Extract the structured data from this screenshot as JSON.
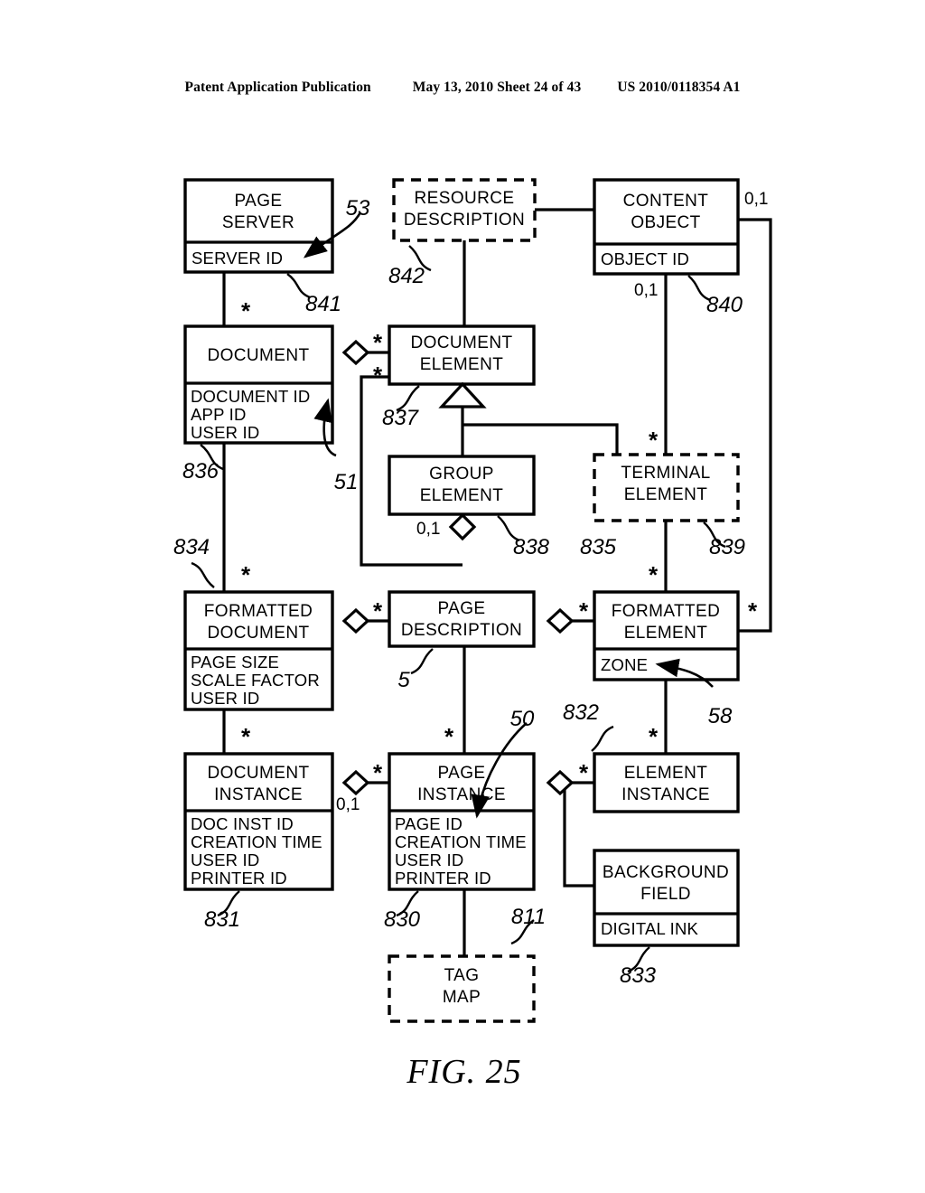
{
  "header": {
    "publication": "Patent Application Publication",
    "date_sheet": "May 13, 2010  Sheet 24 of 43",
    "patent_number": "US 2010/0118354 A1"
  },
  "figure": {
    "label": "FIG. 25",
    "type": "uml-class-diagram"
  },
  "entities": [
    {
      "id": "page-server",
      "name": "PAGE\nSERVER",
      "line1": "PAGE",
      "line2": "SERVER",
      "attributes": [
        "SERVER ID"
      ],
      "style": "solid"
    },
    {
      "id": "resource-description",
      "name": "RESOURCE\nDESCRIPTION",
      "line1": "RESOURCE",
      "line2": "DESCRIPTION",
      "attributes": [],
      "style": "dashed"
    },
    {
      "id": "content-object",
      "name": "CONTENT\nOBJECT",
      "line1": "CONTENT",
      "line2": "OBJECT",
      "attributes": [
        "OBJECT ID"
      ],
      "style": "solid"
    },
    {
      "id": "document",
      "name": "DOCUMENT",
      "line1": "DOCUMENT",
      "line2": "",
      "attributes": [
        "DOCUMENT ID",
        "APP ID",
        "USER ID"
      ],
      "style": "solid"
    },
    {
      "id": "document-element",
      "name": "DOCUMENT\nELEMENT",
      "line1": "DOCUMENT",
      "line2": "ELEMENT",
      "attributes": [],
      "style": "solid"
    },
    {
      "id": "group-element",
      "name": "GROUP\nELEMENT",
      "line1": "GROUP",
      "line2": "ELEMENT",
      "attributes": [],
      "style": "solid"
    },
    {
      "id": "terminal-element",
      "name": "TERMINAL\nELEMENT",
      "line1": "TERMINAL",
      "line2": "ELEMENT",
      "attributes": [],
      "style": "dashed"
    },
    {
      "id": "formatted-document",
      "name": "FORMATTED\nDOCUMENT",
      "line1": "FORMATTED",
      "line2": "DOCUMENT",
      "attributes": [
        "PAGE SIZE",
        "SCALE FACTOR",
        "USER ID"
      ],
      "style": "solid"
    },
    {
      "id": "page-description",
      "name": "PAGE\nDESCRIPTION",
      "line1": "PAGE",
      "line2": "DESCRIPTION",
      "attributes": [],
      "style": "solid"
    },
    {
      "id": "formatted-element",
      "name": "FORMATTED\nELEMENT",
      "line1": "FORMATTED",
      "line2": "ELEMENT",
      "attributes": [
        "ZONE"
      ],
      "style": "solid"
    },
    {
      "id": "document-instance",
      "name": "DOCUMENT\nINSTANCE",
      "line1": "DOCUMENT",
      "line2": "INSTANCE",
      "attributes": [
        "DOC INST ID",
        "CREATION TIME",
        "USER ID",
        "PRINTER ID"
      ],
      "style": "solid"
    },
    {
      "id": "page-instance",
      "name": "PAGE\nINSTANCE",
      "line1": "PAGE",
      "line2": "INSTANCE",
      "attributes": [
        "PAGE ID",
        "CREATION TIME",
        "USER ID",
        "PRINTER ID"
      ],
      "style": "solid"
    },
    {
      "id": "element-instance",
      "name": "ELEMENT\nINSTANCE",
      "line1": "ELEMENT",
      "line2": "INSTANCE",
      "attributes": [],
      "style": "solid"
    },
    {
      "id": "background-field",
      "name": "BACKGROUND\nFIELD",
      "line1": "BACKGROUND",
      "line2": "FIELD",
      "attributes": [
        "DIGITAL INK"
      ],
      "style": "solid"
    },
    {
      "id": "tag-map",
      "name": "TAG\nMAP",
      "line1": "TAG",
      "line2": "MAP",
      "attributes": [],
      "style": "dashed"
    }
  ],
  "reference_numerals": [
    {
      "id": "ref-53",
      "text": "53",
      "points_to": "page-server.SERVER ID"
    },
    {
      "id": "ref-842",
      "text": "842",
      "points_to": "resource-description"
    },
    {
      "id": "ref-841",
      "text": "841",
      "points_to": "page-server"
    },
    {
      "id": "ref-840",
      "text": "840",
      "points_to": "content-object"
    },
    {
      "id": "ref-836",
      "text": "836",
      "points_to": "document"
    },
    {
      "id": "ref-837",
      "text": "837",
      "points_to": "document-element"
    },
    {
      "id": "ref-51",
      "text": "51",
      "points_to": "document.DOCUMENT ID"
    },
    {
      "id": "ref-838",
      "text": "838",
      "points_to": "group-element"
    },
    {
      "id": "ref-835",
      "text": "835",
      "points_to": "terminal-element"
    },
    {
      "id": "ref-839",
      "text": "839",
      "points_to": "terminal-element"
    },
    {
      "id": "ref-834",
      "text": "834",
      "points_to": "formatted-document"
    },
    {
      "id": "ref-5",
      "text": "5",
      "points_to": "page-description"
    },
    {
      "id": "ref-58",
      "text": "58",
      "points_to": "formatted-element.ZONE"
    },
    {
      "id": "ref-832",
      "text": "832",
      "points_to": "element-instance"
    },
    {
      "id": "ref-831",
      "text": "831",
      "points_to": "document-instance"
    },
    {
      "id": "ref-830",
      "text": "830",
      "points_to": "page-instance"
    },
    {
      "id": "ref-50",
      "text": "50",
      "points_to": "page-instance.PAGE ID"
    },
    {
      "id": "ref-811",
      "text": "811",
      "points_to": "tag-map"
    },
    {
      "id": "ref-833",
      "text": "833",
      "points_to": "background-field"
    }
  ],
  "multiplicities": [
    {
      "id": "mult-content-object-right",
      "text": "0,1"
    },
    {
      "id": "mult-object-id-below",
      "text": "0,1"
    },
    {
      "id": "mult-group-element",
      "text": "0,1"
    },
    {
      "id": "mult-document-instance",
      "text": "0,1"
    },
    {
      "id": "mult-star",
      "text": "*"
    }
  ]
}
